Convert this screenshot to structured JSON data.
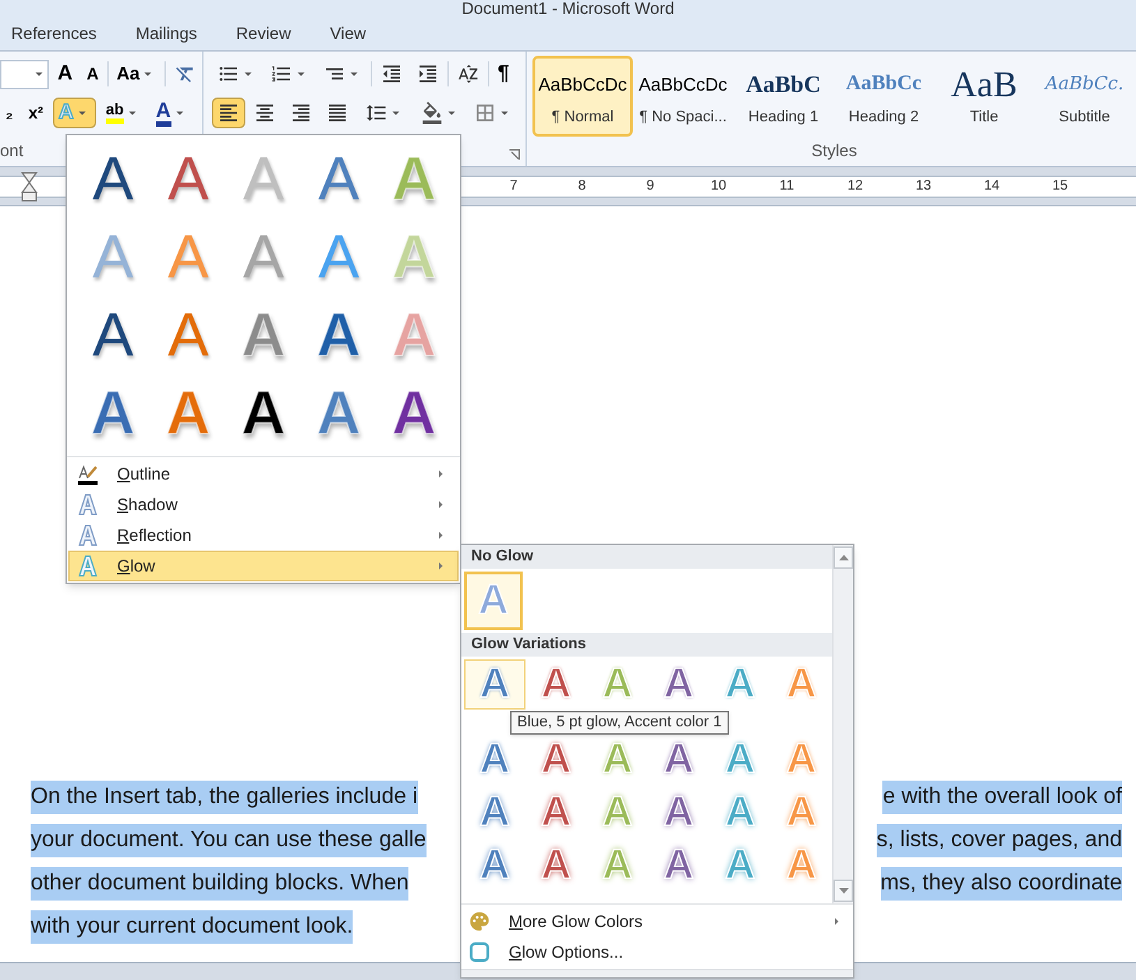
{
  "window": {
    "title": "Document1 - Microsoft Word"
  },
  "ribbon_tabs": [
    "References",
    "Mailings",
    "Review",
    "View"
  ],
  "font_group": {
    "label": "ont",
    "grow_glyph": "A",
    "shrink_glyph": "A",
    "case_glyph": "Aa",
    "subscript_glyph": "₂",
    "superscript_glyph": "x²",
    "text_effects": {
      "glyph": "A",
      "selected": true
    },
    "highlight_glyph": "ab",
    "font_color_glyph": "A"
  },
  "paragraph_group": {
    "pilcrow_glyph": "¶",
    "alignments": [
      {
        "kind": "left",
        "selected": true
      },
      {
        "kind": "center",
        "selected": false
      },
      {
        "kind": "right",
        "selected": false
      },
      {
        "kind": "justify",
        "selected": false
      }
    ]
  },
  "styles": {
    "label": "Styles",
    "items": [
      {
        "preview": "AaBbCcDc",
        "name": "¶ Normal",
        "kind": "normal",
        "selected": true
      },
      {
        "preview": "AaBbCcDc",
        "name": "¶ No Spaci...",
        "kind": "normal",
        "selected": false
      },
      {
        "preview": "AaBbC",
        "name": "Heading 1",
        "kind": "heading1",
        "selected": false
      },
      {
        "preview": "AaBbCc",
        "name": "Heading 2",
        "kind": "heading2",
        "selected": false
      },
      {
        "preview": "AaB",
        "name": "Title",
        "kind": "title",
        "selected": false
      },
      {
        "preview": "AaBbCc.",
        "name": "Subtitle",
        "kind": "subtitle",
        "selected": false
      }
    ]
  },
  "ruler": {
    "numbers": [
      "7",
      "8",
      "9",
      "10",
      "11",
      "12",
      "13",
      "14",
      "15"
    ]
  },
  "document": {
    "lines": [
      {
        "left": "On the Insert tab, the galleries include i",
        "right": "e with the overall look of"
      },
      {
        "left": "your document. You can use these galle",
        "right": "s, lists, cover pages, and"
      },
      {
        "left": "other document building blocks. When",
        "right": "ms, they also coordinate"
      },
      {
        "left": "with your current document look."
      }
    ]
  },
  "text_effects_menu": {
    "gallery": [
      [
        {
          "glyph": "A",
          "kind": "outline",
          "color": "#1f497d"
        },
        {
          "glyph": "A",
          "kind": "outline",
          "color": "#c0504d"
        },
        {
          "glyph": "A",
          "kind": "outline",
          "color": "#bfbfbf"
        },
        {
          "glyph": "A",
          "kind": "outline",
          "color": "#4f81bd"
        },
        {
          "glyph": "A",
          "kind": "fill",
          "color": "#9bbb59"
        }
      ],
      [
        {
          "glyph": "A",
          "kind": "outline",
          "color": "#95b3d7"
        },
        {
          "glyph": "A",
          "kind": "outline",
          "color": "#f79646"
        },
        {
          "glyph": "A",
          "kind": "outline",
          "color": "#a6a6a6"
        },
        {
          "glyph": "A",
          "kind": "outline",
          "color": "#4aa3f0"
        },
        {
          "glyph": "A",
          "kind": "fill",
          "color": "#c3d69b"
        }
      ],
      [
        {
          "glyph": "A",
          "kind": "outline",
          "color": "#1f497d"
        },
        {
          "glyph": "A",
          "kind": "outline",
          "color": "#e36c09"
        },
        {
          "glyph": "A",
          "kind": "fill",
          "color": "#8c8c8c"
        },
        {
          "glyph": "A",
          "kind": "fill",
          "color": "#1f5fa8"
        },
        {
          "glyph": "A",
          "kind": "fill",
          "color": "#e6a3a1"
        }
      ],
      [
        {
          "glyph": "A",
          "kind": "fill",
          "color": "#3a6db3"
        },
        {
          "glyph": "A",
          "kind": "fill",
          "color": "#e46c0a"
        },
        {
          "glyph": "A",
          "kind": "fill",
          "color": "#000000"
        },
        {
          "glyph": "A",
          "kind": "fill",
          "color": "#4f81bd"
        },
        {
          "glyph": "A",
          "kind": "fill",
          "color": "#7030a0"
        }
      ]
    ],
    "items": [
      {
        "label": "Outline",
        "kind": "outline",
        "selected": false
      },
      {
        "label": "Shadow",
        "kind": "shadow",
        "selected": false
      },
      {
        "label": "Reflection",
        "kind": "reflection",
        "selected": false
      },
      {
        "label": "Glow",
        "kind": "glow",
        "selected": true
      }
    ]
  },
  "glow_menu": {
    "no_glow": {
      "heading": "No Glow",
      "item": {
        "glyph": "A",
        "selected": true
      }
    },
    "variations": {
      "heading": "Glow Variations",
      "rows": [
        {
          "kind": "small",
          "items": [
            {
              "glyph": "A",
              "color": "#4f81bd",
              "selected": true
            },
            {
              "glyph": "A",
              "color": "#c0504d",
              "selected": false
            },
            {
              "glyph": "A",
              "color": "#9bbb59",
              "selected": false
            },
            {
              "glyph": "A",
              "color": "#8064a2",
              "selected": false
            },
            {
              "glyph": "A",
              "color": "#4bacc6",
              "selected": false
            },
            {
              "glyph": "A",
              "color": "#f79646",
              "selected": false
            }
          ]
        },
        {
          "kind": "medium",
          "items": [
            {
              "glyph": "A",
              "color": "#4f81bd",
              "selected": false
            },
            {
              "glyph": "A",
              "color": "#c0504d",
              "selected": false
            },
            {
              "glyph": "A",
              "color": "#9bbb59",
              "selected": false
            },
            {
              "glyph": "A",
              "color": "#8064a2",
              "selected": false
            },
            {
              "glyph": "A",
              "color": "#4bacc6",
              "selected": false
            },
            {
              "glyph": "A",
              "color": "#f79646",
              "selected": false
            }
          ]
        },
        {
          "kind": "large",
          "items": [
            {
              "glyph": "A",
              "color": "#4f81bd",
              "selected": false
            },
            {
              "glyph": "A",
              "color": "#c0504d",
              "selected": false
            },
            {
              "glyph": "A",
              "color": "#9bbb59",
              "selected": false
            },
            {
              "glyph": "A",
              "color": "#8064a2",
              "selected": false
            },
            {
              "glyph": "A",
              "color": "#4bacc6",
              "selected": false
            },
            {
              "glyph": "A",
              "color": "#f79646",
              "selected": false
            }
          ]
        },
        {
          "kind": "xlarge",
          "items": [
            {
              "glyph": "A",
              "color": "#4f81bd",
              "selected": false
            },
            {
              "glyph": "A",
              "color": "#c0504d",
              "selected": false
            },
            {
              "glyph": "A",
              "color": "#9bbb59",
              "selected": false
            },
            {
              "glyph": "A",
              "color": "#8064a2",
              "selected": false
            },
            {
              "glyph": "A",
              "color": "#4bacc6",
              "selected": false
            },
            {
              "glyph": "A",
              "color": "#f79646",
              "selected": false
            }
          ]
        }
      ]
    },
    "actions": [
      {
        "label": "More Glow Colors",
        "kind": "colors"
      },
      {
        "label": "Glow Options...",
        "kind": "options"
      }
    ],
    "tooltip": "Blue, 5 pt glow, Accent color 1"
  }
}
